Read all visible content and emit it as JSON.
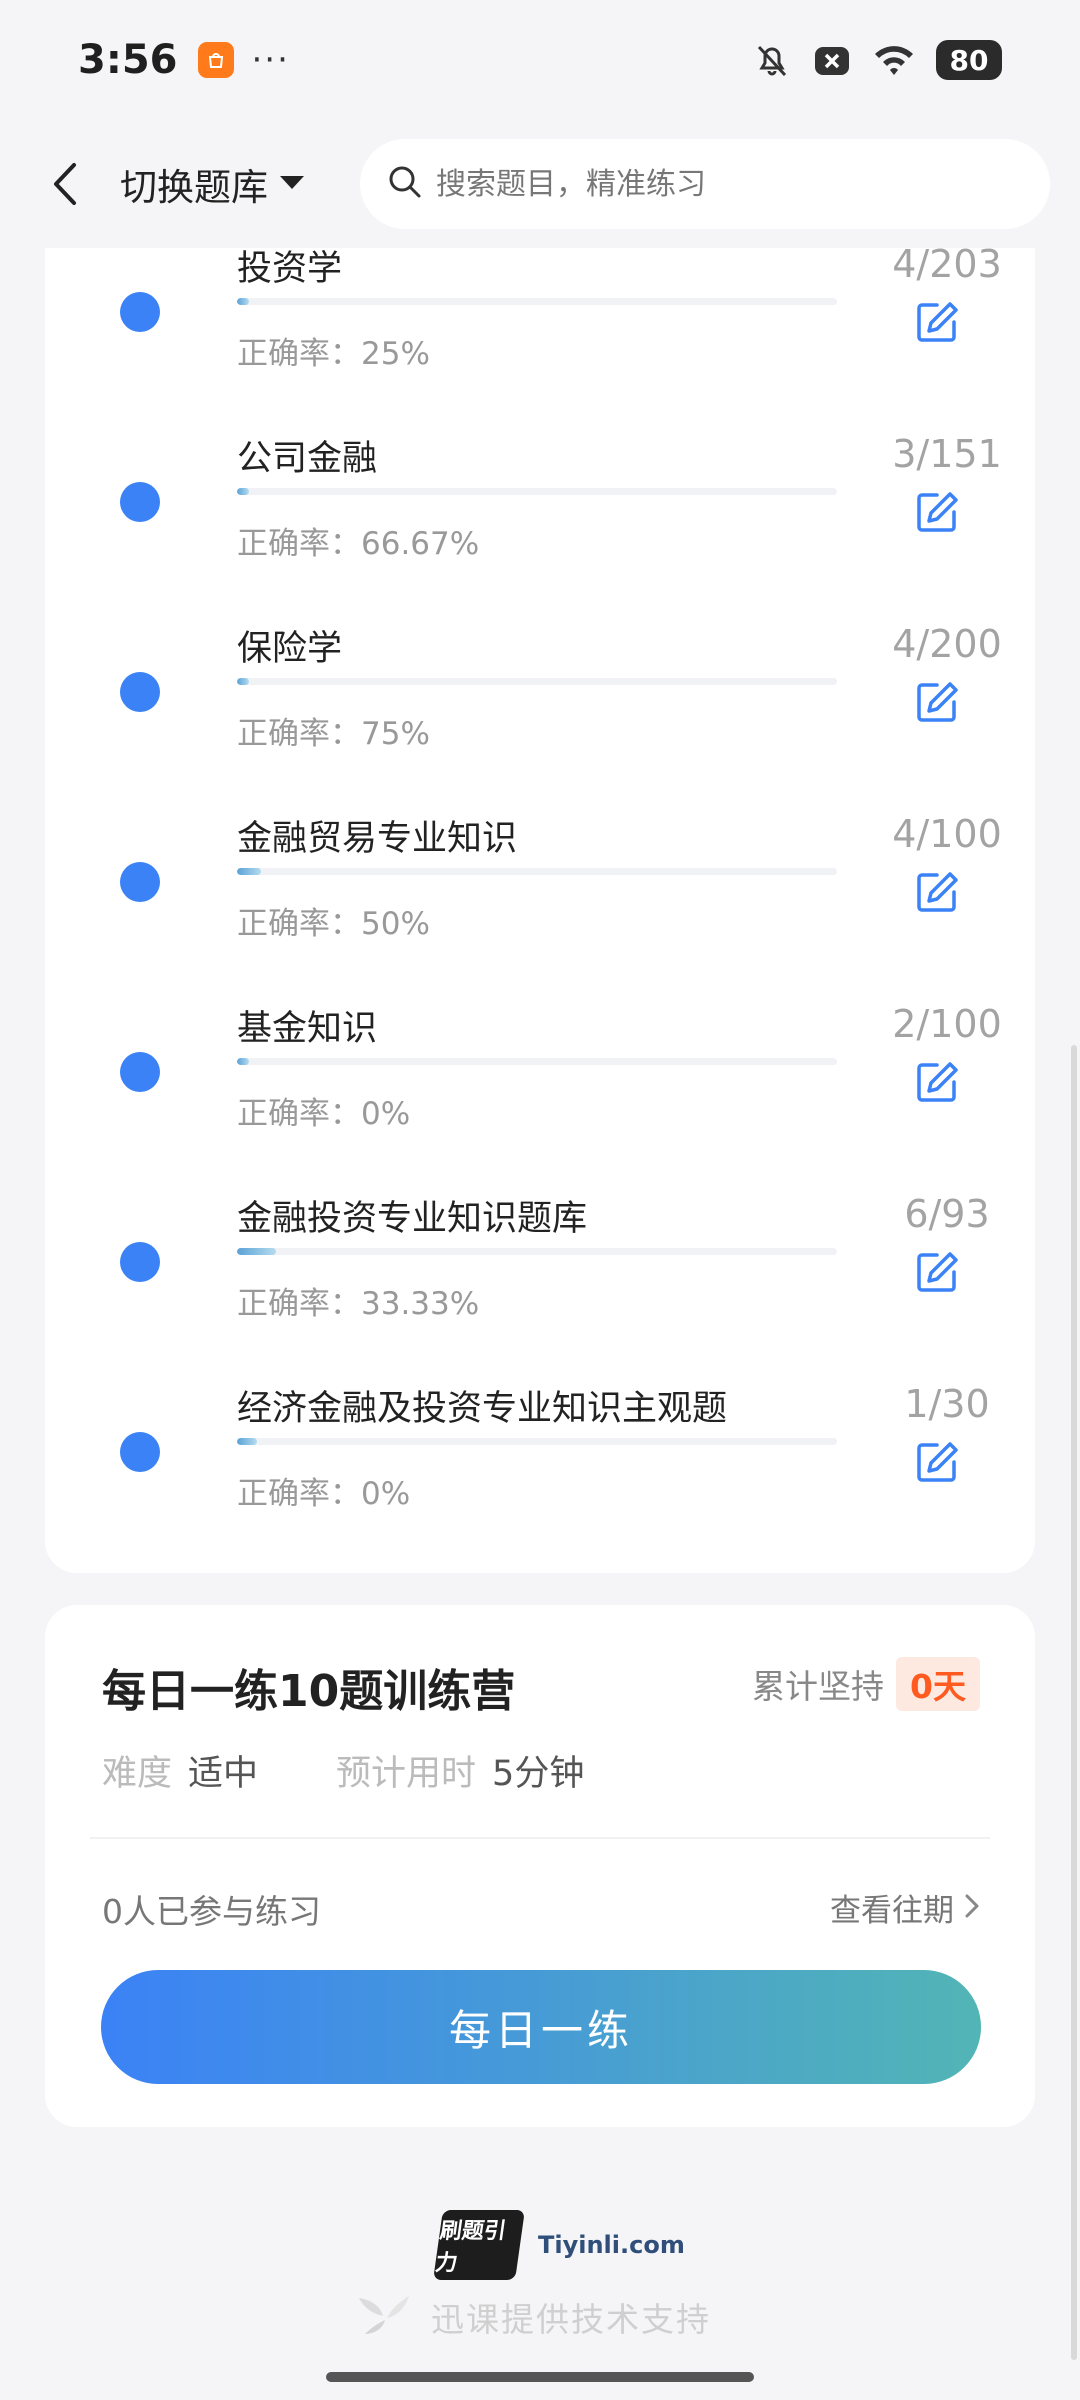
{
  "status_bar": {
    "time": "3:56",
    "battery": "80"
  },
  "header": {
    "switch_label": "切换题库",
    "search_placeholder": "搜索题目，精准练习"
  },
  "subjects": [
    {
      "name": "投资学",
      "rate_label": "正确率：",
      "rate": "25%",
      "count": "4/203",
      "progress": 0.02
    },
    {
      "name": "公司金融",
      "rate_label": "正确率：",
      "rate": "66.67%",
      "count": "3/151",
      "progress": 0.02
    },
    {
      "name": "保险学",
      "rate_label": "正确率：",
      "rate": "75%",
      "count": "4/200",
      "progress": 0.02
    },
    {
      "name": "金融贸易专业知识",
      "rate_label": "正确率：",
      "rate": "50%",
      "count": "4/100",
      "progress": 0.04
    },
    {
      "name": "基金知识",
      "rate_label": "正确率：",
      "rate": "0%",
      "count": "2/100",
      "progress": 0.02
    },
    {
      "name": "金融投资专业知识题库",
      "rate_label": "正确率：",
      "rate": "33.33%",
      "count": "6/93",
      "progress": 0.065
    },
    {
      "name": "经济金融及投资专业知识主观题",
      "rate_label": "正确率：",
      "rate": "0%",
      "count": "1/30",
      "progress": 0.033
    }
  ],
  "daily": {
    "title": "每日一练10题训练营",
    "streak_label": "累计坚持",
    "streak_value": "0天",
    "difficulty_label": "难度",
    "difficulty_value": "适中",
    "time_label": "预计用时",
    "time_value": "5分钟",
    "participants": "0人已参与练习",
    "history_label": "查看往期",
    "button_label": "每日一练"
  },
  "footer": {
    "logo_text": "刷题引力",
    "domain": "Tiyinli.com",
    "support": "迅课提供技术支持"
  },
  "colors": {
    "accent": "#3a82f6",
    "streak": "#ff5a1f",
    "button_start": "#3b82f6",
    "button_end": "#52b5b5"
  }
}
